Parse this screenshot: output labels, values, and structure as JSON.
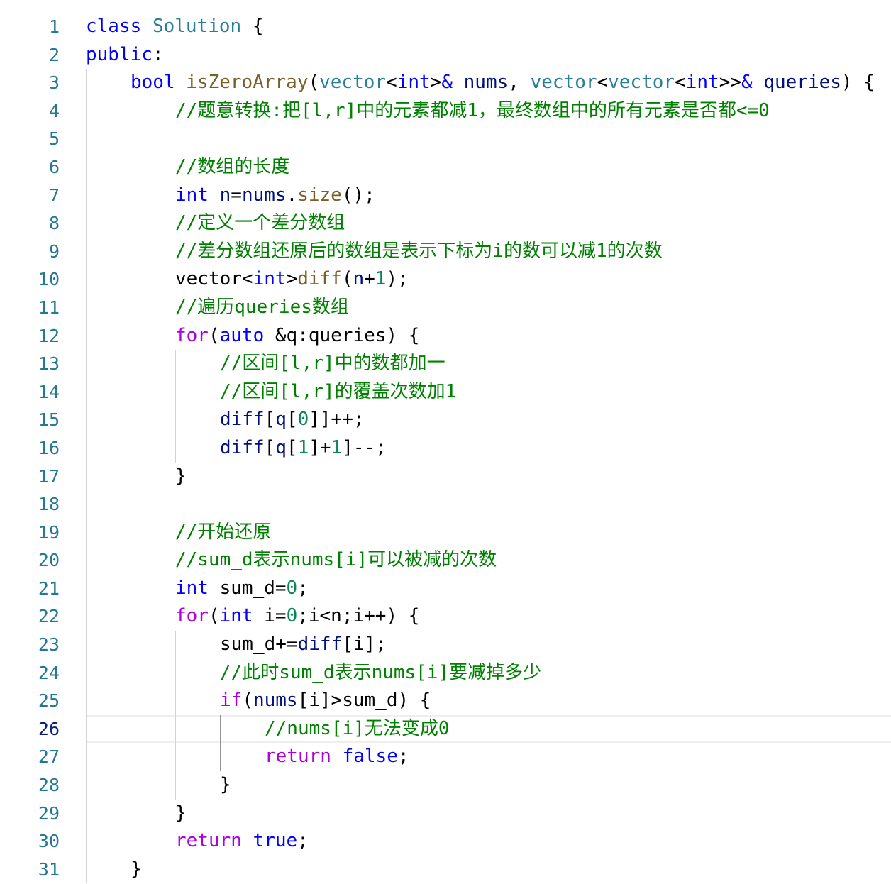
{
  "editor": {
    "current_line": 26,
    "colors": {
      "keyword": "#0000ff",
      "control": "#af00db",
      "type": "#267f99",
      "function": "#795e26",
      "variable": "#001080",
      "number": "#098658",
      "comment": "#008000",
      "text": "#000000",
      "line_number": "#237893",
      "active_line_number": "#0b216f"
    },
    "lines": [
      {
        "n": "1",
        "indent": 0,
        "tokens": [
          [
            "kw",
            "class"
          ],
          [
            "tx",
            " "
          ],
          [
            "ty",
            "Solution"
          ],
          [
            "tx",
            " {"
          ]
        ]
      },
      {
        "n": "2",
        "indent": 0,
        "tokens": [
          [
            "kw",
            "public"
          ],
          [
            "tx",
            ":"
          ]
        ]
      },
      {
        "n": "3",
        "indent": 1,
        "tokens": [
          [
            "kw",
            "bool"
          ],
          [
            "tx",
            " "
          ],
          [
            "fn",
            "isZeroArray"
          ],
          [
            "tx",
            "("
          ],
          [
            "ty",
            "vector"
          ],
          [
            "tx",
            "<"
          ],
          [
            "kw",
            "int"
          ],
          [
            "tx",
            ">"
          ],
          [
            "kw",
            "&"
          ],
          [
            "tx",
            " "
          ],
          [
            "var",
            "nums"
          ],
          [
            "tx",
            ", "
          ],
          [
            "ty",
            "vector"
          ],
          [
            "tx",
            "<"
          ],
          [
            "ty",
            "vector"
          ],
          [
            "tx",
            "<"
          ],
          [
            "kw",
            "int"
          ],
          [
            "tx",
            ">>"
          ],
          [
            "kw",
            "&"
          ],
          [
            "tx",
            " "
          ],
          [
            "var",
            "queries"
          ],
          [
            "tx",
            ") {"
          ]
        ]
      },
      {
        "n": "4",
        "indent": 2,
        "tokens": [
          [
            "cm",
            "//题意转换:把[l,r]中的元素都减1，最终数组中的所有元素是否都<=0"
          ]
        ]
      },
      {
        "n": "5",
        "indent": 2,
        "tokens": []
      },
      {
        "n": "6",
        "indent": 2,
        "tokens": [
          [
            "cm",
            "//数组的长度"
          ]
        ]
      },
      {
        "n": "7",
        "indent": 2,
        "tokens": [
          [
            "kw",
            "int"
          ],
          [
            "tx",
            " "
          ],
          [
            "var",
            "n"
          ],
          [
            "tx",
            "="
          ],
          [
            "var",
            "nums"
          ],
          [
            "tx",
            "."
          ],
          [
            "fn",
            "size"
          ],
          [
            "tx",
            "();"
          ]
        ]
      },
      {
        "n": "8",
        "indent": 2,
        "tokens": [
          [
            "cm",
            "//定义一个差分数组"
          ]
        ]
      },
      {
        "n": "9",
        "indent": 2,
        "tokens": [
          [
            "cm",
            "//差分数组还原后的数组是表示下标为i的数可以减1的次数"
          ]
        ]
      },
      {
        "n": "10",
        "indent": 2,
        "tokens": [
          [
            "tx",
            "vector<"
          ],
          [
            "kw",
            "int"
          ],
          [
            "tx",
            ">"
          ],
          [
            "fn",
            "diff"
          ],
          [
            "tx",
            "("
          ],
          [
            "var",
            "n"
          ],
          [
            "tx",
            "+"
          ],
          [
            "num",
            "1"
          ],
          [
            "tx",
            ");"
          ]
        ]
      },
      {
        "n": "11",
        "indent": 2,
        "tokens": [
          [
            "cm",
            "//遍历queries数组"
          ]
        ]
      },
      {
        "n": "12",
        "indent": 2,
        "tokens": [
          [
            "ctl",
            "for"
          ],
          [
            "tx",
            "("
          ],
          [
            "kw",
            "auto"
          ],
          [
            "tx",
            " &q:queries) {"
          ]
        ]
      },
      {
        "n": "13",
        "indent": 3,
        "tokens": [
          [
            "cm",
            "//区间[l,r]中的数都加一"
          ]
        ]
      },
      {
        "n": "14",
        "indent": 3,
        "tokens": [
          [
            "cm",
            "//区间[l,r]的覆盖次数加1"
          ]
        ]
      },
      {
        "n": "15",
        "indent": 3,
        "tokens": [
          [
            "var",
            "diff"
          ],
          [
            "tx",
            "["
          ],
          [
            "var",
            "q"
          ],
          [
            "tx",
            "["
          ],
          [
            "num",
            "0"
          ],
          [
            "tx",
            "]]++;"
          ]
        ]
      },
      {
        "n": "16",
        "indent": 3,
        "tokens": [
          [
            "var",
            "diff"
          ],
          [
            "tx",
            "["
          ],
          [
            "var",
            "q"
          ],
          [
            "tx",
            "["
          ],
          [
            "num",
            "1"
          ],
          [
            "tx",
            "]+"
          ],
          [
            "num",
            "1"
          ],
          [
            "tx",
            "]--;"
          ]
        ]
      },
      {
        "n": "17",
        "indent": 2,
        "tokens": [
          [
            "tx",
            "}"
          ]
        ]
      },
      {
        "n": "18",
        "indent": 2,
        "tokens": []
      },
      {
        "n": "19",
        "indent": 2,
        "tokens": [
          [
            "cm",
            "//开始还原"
          ]
        ]
      },
      {
        "n": "20",
        "indent": 2,
        "tokens": [
          [
            "cm",
            "//sum_d表示nums[i]可以被减的次数"
          ]
        ]
      },
      {
        "n": "21",
        "indent": 2,
        "tokens": [
          [
            "kw",
            "int"
          ],
          [
            "tx",
            " sum_d="
          ],
          [
            "num",
            "0"
          ],
          [
            "tx",
            ";"
          ]
        ]
      },
      {
        "n": "22",
        "indent": 2,
        "tokens": [
          [
            "ctl",
            "for"
          ],
          [
            "tx",
            "("
          ],
          [
            "kw",
            "int"
          ],
          [
            "tx",
            " i="
          ],
          [
            "num",
            "0"
          ],
          [
            "tx",
            ";i<n;i++) {"
          ]
        ]
      },
      {
        "n": "23",
        "indent": 3,
        "tokens": [
          [
            "tx",
            "sum_d+="
          ],
          [
            "var",
            "diff"
          ],
          [
            "tx",
            "[i];"
          ]
        ]
      },
      {
        "n": "24",
        "indent": 3,
        "tokens": [
          [
            "cm",
            "//此时sum_d表示nums[i]要减掉多少"
          ]
        ]
      },
      {
        "n": "25",
        "indent": 3,
        "tokens": [
          [
            "ctl",
            "if"
          ],
          [
            "tx",
            "("
          ],
          [
            "var",
            "nums"
          ],
          [
            "tx",
            "[i]>sum_d) {"
          ]
        ]
      },
      {
        "n": "26",
        "indent": 4,
        "tokens": [
          [
            "cm",
            "//nums[i]无法变成0"
          ]
        ]
      },
      {
        "n": "27",
        "indent": 4,
        "tokens": [
          [
            "ctl",
            "return"
          ],
          [
            "tx",
            " "
          ],
          [
            "kw",
            "false"
          ],
          [
            "tx",
            ";"
          ]
        ]
      },
      {
        "n": "28",
        "indent": 3,
        "tokens": [
          [
            "tx",
            "}"
          ]
        ]
      },
      {
        "n": "29",
        "indent": 2,
        "tokens": [
          [
            "tx",
            "}"
          ]
        ]
      },
      {
        "n": "30",
        "indent": 2,
        "tokens": [
          [
            "ctl",
            "return"
          ],
          [
            "tx",
            " "
          ],
          [
            "kw",
            "true"
          ],
          [
            "tx",
            ";"
          ]
        ]
      },
      {
        "n": "31",
        "indent": 1,
        "tokens": [
          [
            "tx",
            "}"
          ]
        ]
      }
    ]
  }
}
